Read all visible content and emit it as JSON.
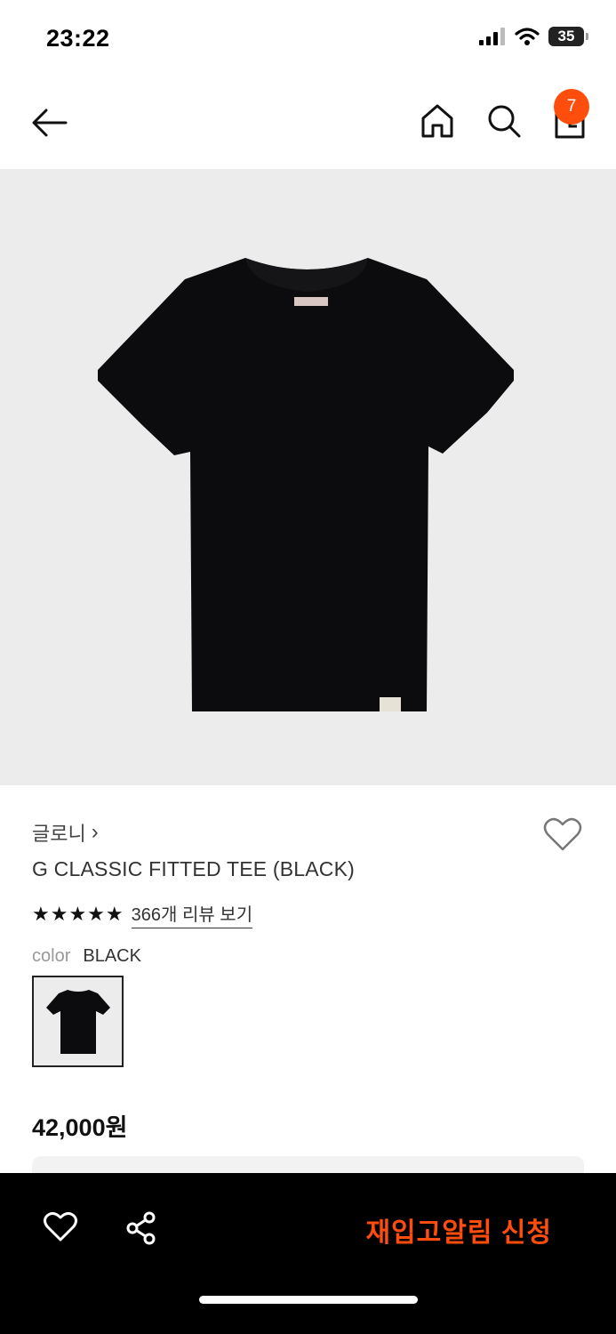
{
  "status_bar": {
    "time": "23:22",
    "battery": "35"
  },
  "header": {
    "cart_count": "7"
  },
  "product": {
    "brand": "글로니",
    "brand_chevron": "›",
    "name": "G CLASSIC FITTED TEE (BLACK)",
    "stars": "★★★★★",
    "rating": 5,
    "review_link": "366개 리뷰 보기",
    "color_label": "color",
    "color_value": "BLACK",
    "price": "42,000원"
  },
  "bottom_bar": {
    "restock_label": "재입고알림 신청"
  },
  "colors": {
    "accent": "#ff4d0d",
    "image_bg": "#ececec",
    "bottom_bar": "#000000"
  }
}
